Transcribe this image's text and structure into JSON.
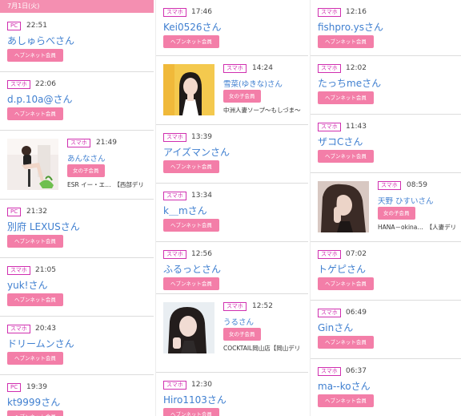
{
  "header": {
    "date": "7月1日(火)"
  },
  "labels": {
    "member_button": "ヘブンネット会員",
    "girl_button": "女の子会員"
  },
  "badges": {
    "pc": "PC",
    "smartphone": "スマホ"
  },
  "columns": [
    [
      {
        "badge": "PC",
        "time": "22:51",
        "name": "あしゅらべさん",
        "type": "member"
      },
      {
        "badge": "スマホ",
        "time": "22:06",
        "name": "d.p.10a@さん",
        "type": "member"
      },
      {
        "badge": "スマホ",
        "time": "21:49",
        "name": "あんなさん",
        "type": "girl",
        "shop": "ESR イー・エ…　【西部デリ",
        "photo": "girl-photo-chair"
      },
      {
        "badge": "PC",
        "time": "21:32",
        "name": "別府 LEXUSさん",
        "type": "member"
      },
      {
        "badge": "スマホ",
        "time": "21:05",
        "name": "yuk!さん",
        "type": "member"
      },
      {
        "badge": "スマホ",
        "time": "20:43",
        "name": "ドリームンさん",
        "type": "member"
      },
      {
        "badge": "PC",
        "time": "19:39",
        "name": "kt9999さん",
        "type": "member"
      }
    ],
    [
      {
        "badge": "スマホ",
        "time": "17:46",
        "name": "Kei0526さん",
        "type": "member"
      },
      {
        "badge": "スマホ",
        "time": "14:24",
        "name": "雪菜(ゆきな)さん",
        "type": "girl",
        "shop": "中洲人妻ソープ～もしづま～",
        "photo": "girl-photo-yellow"
      },
      {
        "badge": "スマホ",
        "time": "13:39",
        "name": "アイズマンさん",
        "type": "member"
      },
      {
        "badge": "スマホ",
        "time": "13:34",
        "name": "k＿mさん",
        "type": "member"
      },
      {
        "badge": "スマホ",
        "time": "12:56",
        "name": "ふるっとさん",
        "type": "member"
      },
      {
        "badge": "スマホ",
        "time": "12:52",
        "name": "うるさん",
        "type": "girl",
        "shop": "COCKTAIL岡山店【岡山デリ",
        "photo": "girl-photo-dark"
      },
      {
        "badge": "スマホ",
        "time": "12:30",
        "name": "Hiro1103さん",
        "type": "member"
      }
    ],
    [
      {
        "badge": "スマホ",
        "time": "12:16",
        "name": "fishpro.ysさん",
        "type": "member"
      },
      {
        "badge": "スマホ",
        "time": "12:02",
        "name": "たっちmeさん",
        "type": "member"
      },
      {
        "badge": "スマホ",
        "time": "11:43",
        "name": "ザコCさん",
        "type": "member"
      },
      {
        "badge": "スマホ",
        "time": "08:59",
        "name": "天野 ひすいさん",
        "type": "girl",
        "shop": "HANA－okina…　【人妻デリ",
        "photo": "girl-photo-hand"
      },
      {
        "badge": "スマホ",
        "time": "07:02",
        "name": "トゲピさん",
        "type": "member"
      },
      {
        "badge": "スマホ",
        "time": "06:49",
        "name": "Ginさん",
        "type": "member"
      },
      {
        "badge": "スマホ",
        "time": "06:37",
        "name": "ma--koさん",
        "type": "member"
      }
    ]
  ],
  "colors": {
    "accent_pink": "#f37ea8",
    "badge_magenta": "#d02fb0",
    "link_blue": "#3f7fd0",
    "date_bar": "#f48fb1"
  }
}
